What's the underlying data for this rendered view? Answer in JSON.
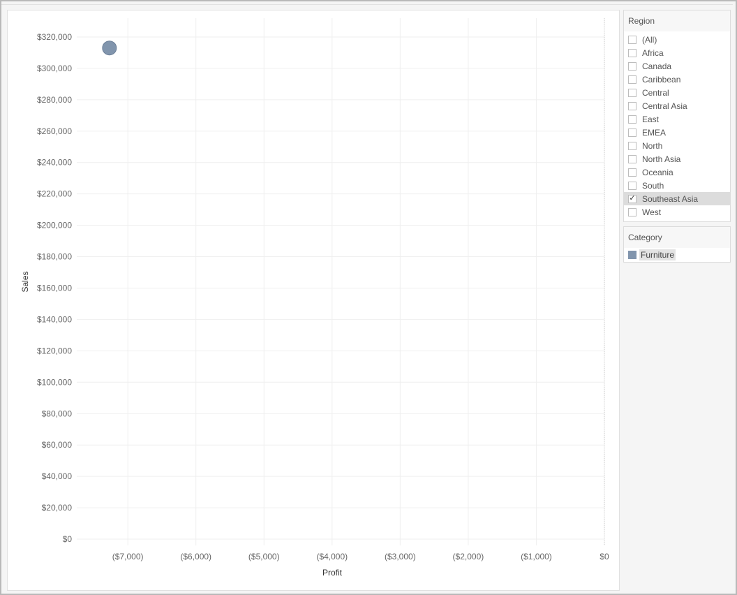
{
  "chart_data": {
    "type": "scatter",
    "xlabel": "Profit",
    "ylabel": "Sales",
    "xlim": [
      -7750,
      0
    ],
    "ylim": [
      -4000,
      332000
    ],
    "x_ticks": [
      {
        "value": -7000,
        "label": "($7,000)"
      },
      {
        "value": -6000,
        "label": "($6,000)"
      },
      {
        "value": -5000,
        "label": "($5,000)"
      },
      {
        "value": -4000,
        "label": "($4,000)"
      },
      {
        "value": -3000,
        "label": "($3,000)"
      },
      {
        "value": -2000,
        "label": "($2,000)"
      },
      {
        "value": -1000,
        "label": "($1,000)"
      },
      {
        "value": 0,
        "label": "$0"
      }
    ],
    "y_ticks": [
      {
        "value": 0,
        "label": "$0"
      },
      {
        "value": 20000,
        "label": "$20,000"
      },
      {
        "value": 40000,
        "label": "$40,000"
      },
      {
        "value": 60000,
        "label": "$60,000"
      },
      {
        "value": 80000,
        "label": "$80,000"
      },
      {
        "value": 100000,
        "label": "$100,000"
      },
      {
        "value": 120000,
        "label": "$120,000"
      },
      {
        "value": 140000,
        "label": "$140,000"
      },
      {
        "value": 160000,
        "label": "$160,000"
      },
      {
        "value": 180000,
        "label": "$180,000"
      },
      {
        "value": 200000,
        "label": "$200,000"
      },
      {
        "value": 220000,
        "label": "$220,000"
      },
      {
        "value": 240000,
        "label": "$240,000"
      },
      {
        "value": 260000,
        "label": "$260,000"
      },
      {
        "value": 280000,
        "label": "$280,000"
      },
      {
        "value": 300000,
        "label": "$300,000"
      },
      {
        "value": 320000,
        "label": "$320,000"
      }
    ],
    "grid": true,
    "series": [
      {
        "name": "Furniture",
        "color": "#8195ad",
        "points": [
          {
            "x": -7270,
            "y": 313000
          }
        ]
      }
    ]
  },
  "filters": {
    "region": {
      "title": "Region",
      "items": [
        {
          "label": "(All)",
          "checked": false
        },
        {
          "label": "Africa",
          "checked": false
        },
        {
          "label": "Canada",
          "checked": false
        },
        {
          "label": "Caribbean",
          "checked": false
        },
        {
          "label": "Central",
          "checked": false
        },
        {
          "label": "Central Asia",
          "checked": false
        },
        {
          "label": "East",
          "checked": false
        },
        {
          "label": "EMEA",
          "checked": false
        },
        {
          "label": "North",
          "checked": false
        },
        {
          "label": "North Asia",
          "checked": false
        },
        {
          "label": "Oceania",
          "checked": false
        },
        {
          "label": "South",
          "checked": false
        },
        {
          "label": "Southeast Asia",
          "checked": true
        },
        {
          "label": "West",
          "checked": false
        }
      ]
    }
  },
  "legend": {
    "title": "Category",
    "items": [
      {
        "label": "Furniture",
        "color": "#8195ad"
      }
    ]
  }
}
